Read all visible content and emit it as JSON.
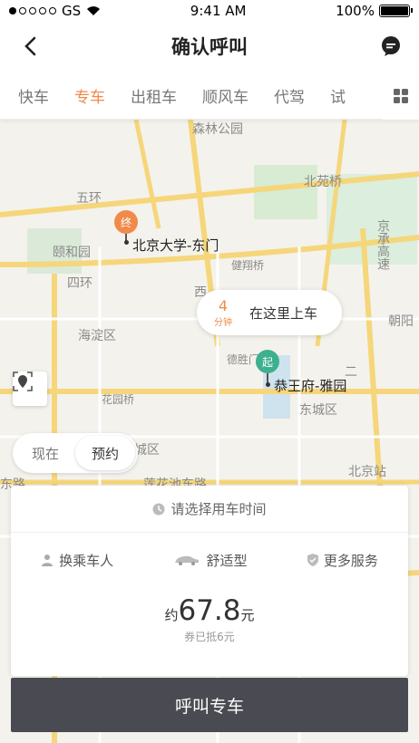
{
  "status_bar": {
    "carrier": "GS",
    "time": "9:41 AM",
    "battery": "100%"
  },
  "nav": {
    "title": "确认呼叫"
  },
  "tabs": [
    {
      "label": "快车",
      "active": false
    },
    {
      "label": "专车",
      "active": true
    },
    {
      "label": "出租车",
      "active": false
    },
    {
      "label": "顺风车",
      "active": false
    },
    {
      "label": "代驾",
      "active": false
    },
    {
      "label": "试",
      "active": false
    }
  ],
  "map": {
    "labels": [
      "森林公园",
      "北苑桥",
      "五环",
      "颐和园",
      "京承高速",
      "健翔桥",
      "四环",
      "西",
      "朝阳",
      "海淀区",
      "德胜门",
      "二",
      "花园桥",
      "东城区",
      "北京站",
      "城区",
      "莲花池东路",
      "东路"
    ],
    "destination": {
      "badge": "终",
      "name": "北京大学-东门"
    },
    "origin": {
      "badge": "起",
      "name": "恭王府-雅园"
    },
    "pickup_bubble": {
      "eta_value": "4",
      "eta_unit": "分钟",
      "text": "在这里上车"
    }
  },
  "time_toggle": {
    "now": "现在",
    "reserve": "预约",
    "selected": "预约"
  },
  "panel": {
    "time_prompt": "请选择用车时间",
    "options": {
      "passenger": "换乘车人",
      "car_type": "舒适型",
      "more": "更多服务"
    },
    "price_prefix": "约",
    "price_value": "67.8",
    "price_unit": "元",
    "coupon": "券已抵6元"
  },
  "call_button": "呼叫专车",
  "colors": {
    "accent": "#f08a4b",
    "origin": "#3cb08f",
    "button": "#4a4a52"
  }
}
